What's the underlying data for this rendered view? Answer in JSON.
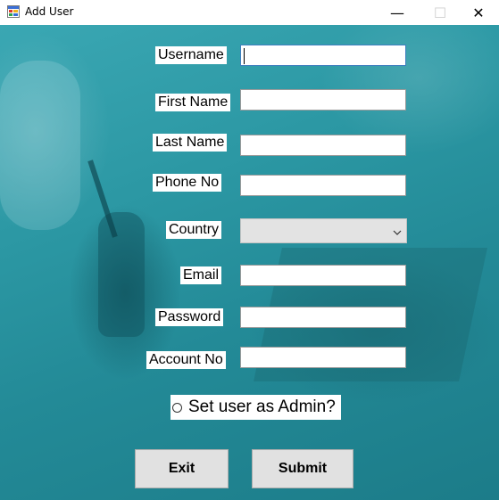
{
  "window": {
    "title": "Add User",
    "icons": {
      "app": "app-window-icon",
      "minimize": "minimize-icon",
      "maximize": "maximize-icon",
      "close": "close-icon"
    },
    "minimize_glyph": "—",
    "maximize_glyph": "☐",
    "close_glyph": "✕"
  },
  "form": {
    "username": {
      "label": "Username",
      "value": ""
    },
    "first_name": {
      "label": "First Name",
      "value": ""
    },
    "last_name": {
      "label": "Last Name",
      "value": ""
    },
    "phone_no": {
      "label": "Phone No",
      "value": ""
    },
    "country": {
      "label": "Country",
      "value": ""
    },
    "email": {
      "label": "Email",
      "value": ""
    },
    "password": {
      "label": "Password",
      "value": ""
    },
    "account_no": {
      "label": "Account No",
      "value": ""
    },
    "admin_radio": {
      "label": "Set user as Admin?",
      "checked": false
    }
  },
  "buttons": {
    "exit": "Exit",
    "submit": "Submit"
  },
  "colors": {
    "background_accent": "#2b97a3",
    "button_bg": "#e1e1e1",
    "combo_bg": "#e3e3e3"
  }
}
